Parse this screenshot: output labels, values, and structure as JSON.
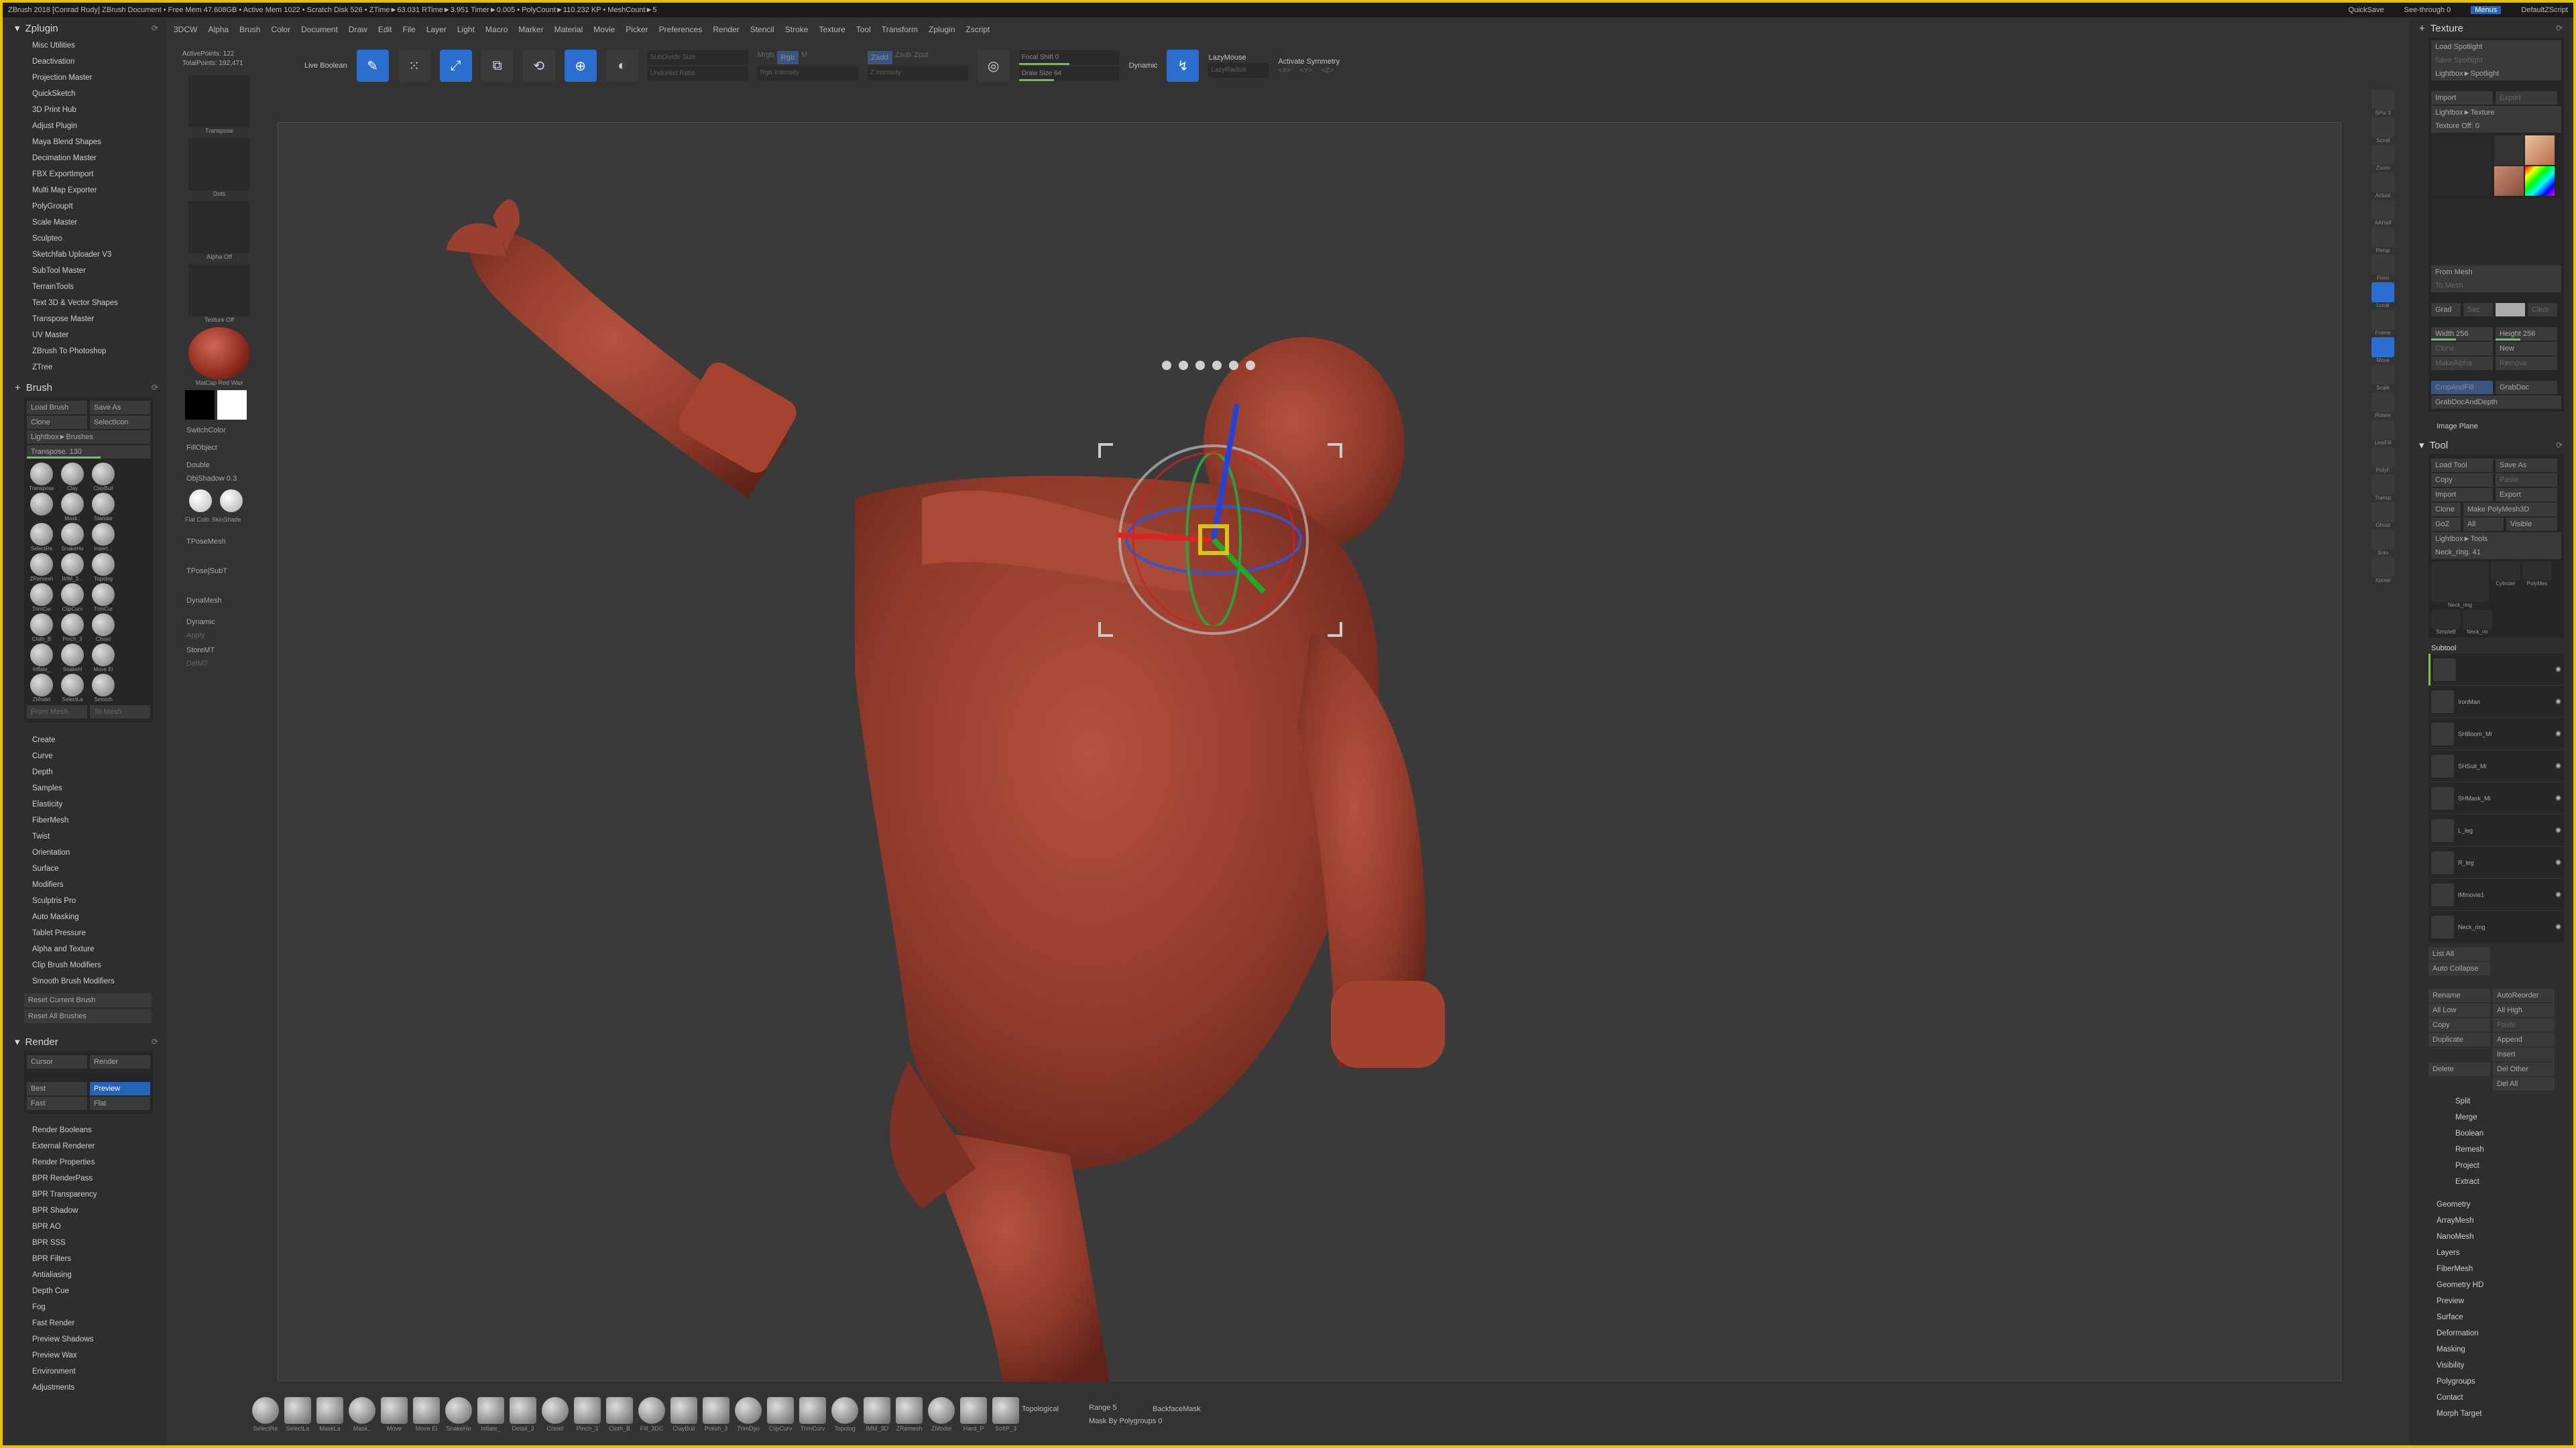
{
  "titlebar": {
    "text": "ZBrush 2018 [Conrad Rudy]   ZBrush Document   • Free Mem 47.608GB • Active Mem 1022 • Scratch Disk 526 • ZTime►63.031 RTime►3.951 Timer►0.005 • PolyCount►110.232 KP • MeshCount►5",
    "quicksave": "QuickSave",
    "seethrough": "See-through  0",
    "menus_label": "Menus",
    "defaultzscript": "DefaultZScript"
  },
  "menubar": [
    "3DCW",
    "Alpha",
    "Brush",
    "Color",
    "Document",
    "Draw",
    "Edit",
    "File",
    "Layer",
    "Light",
    "Macro",
    "Marker",
    "Material",
    "Movie",
    "Picker",
    "Preferences",
    "Render",
    "Stencil",
    "Stroke",
    "Texture",
    "Tool",
    "Transform",
    "Zplugin",
    "Zscript"
  ],
  "zplugin": {
    "title": "Zplugin",
    "items": [
      "Misc Utilities",
      "Deactivation",
      "Projection Master",
      "QuickSketch",
      "3D Print Hub",
      "Adjust Plugin",
      "Maya Blend Shapes",
      "Decimation Master",
      "FBX ExportImport",
      "Multi Map Exporter",
      "PolyGroupIt",
      "Scale Master",
      "Sculpteo",
      "Sketchfab Uploader V3",
      "SubTool Master",
      "TerrainTools",
      "Text 3D & Vector Shapes",
      "Transpose Master",
      "UV Master",
      "ZBrush To Photoshop",
      "ZTree"
    ]
  },
  "brush": {
    "title": "Brush",
    "load": "Load Brush",
    "save": "Save As",
    "clone": "Clone",
    "selecticon": "SelectIcon",
    "lightbox": "Lightbox►Brushes",
    "transpose_value": "Transpose. 130",
    "brushes": [
      [
        "Transpose",
        "Clay",
        "ClayBuil"
      ],
      [
        "",
        "Mask..",
        "Standar"
      ],
      [
        "SelectRe",
        "SnakeHo",
        "Insert..."
      ],
      [
        "ZRemesh",
        "IMM_3...",
        "Topolog"
      ],
      [
        "TrimCur",
        "ClipCurv",
        "TrimCur"
      ],
      [
        "Cloth_B",
        "Pinch_3",
        "Chisel"
      ],
      [
        "Inflate_",
        "SnakeH",
        "Move El"
      ],
      [
        "ZModel",
        "SelectLa",
        "Smooth"
      ]
    ],
    "sections": [
      "Create",
      "Curve",
      "Depth",
      "Samples",
      "Elasticity",
      "FiberMesh",
      "Twist",
      "Orientation",
      "Surface",
      "Modifiers",
      "Sculptris Pro",
      "Auto Masking",
      "Tablet Pressure",
      "Alpha and Texture",
      "Clip Brush Modifiers",
      "Smooth Brush Modifiers"
    ],
    "reset_current": "Reset Current Brush",
    "reset_all": "Reset All Brushes"
  },
  "render": {
    "title": "Render",
    "cursor": "Cursor",
    "render": "Render",
    "best": "Best",
    "preview": "Preview",
    "fast": "Fast",
    "flat": "Flat",
    "items": [
      "Render Booleans",
      "External Renderer",
      "Render Properties",
      "BPR RenderPass",
      "BPR Transparency",
      "BPR Shadow",
      "BPR AO",
      "BPR SSS",
      "BPR Filters",
      "Antialiasing",
      "Depth Cue",
      "Fog",
      "Fast Render",
      "Preview Shadows",
      "Preview Wax",
      "Environment",
      "Adjustments"
    ]
  },
  "leftshelf": {
    "active_points": "ActivePoints: 122",
    "total_points": "TotalPoints: 192,471",
    "items": [
      "Transpose",
      "Dots",
      "Alpha Off",
      "Texture Off",
      "MatCap Red Wax"
    ],
    "switchcolor": "SwitchColor",
    "fillobject": "FillObject",
    "double": "Double",
    "objshadow": "ObjShadow 0.3",
    "flat_color": "Flat Colo",
    "skinshade": "SkinShade",
    "tposemesh": "TPoseMesh",
    "tposesubt": "TPose|SubT",
    "dynamesh": "DynaMesh",
    "dynamic": "Dynamic",
    "apply": "Apply",
    "storemt": "StoreMT",
    "delmt": "DelMT"
  },
  "toolbar": {
    "live_boolean": "Live Boolean",
    "edit": "Edit",
    "draw": "Draw",
    "move": "Move",
    "scale": "Scale",
    "rotate": "Rotate",
    "subdiv_size": "SubDivide Size",
    "undohist": "UndoHist Ratio",
    "mrgb": "Mrgb",
    "rgb": "Rgb",
    "m": "M",
    "zadd": "Zadd",
    "zsub": "Zsub",
    "zcut": "Zcut",
    "rgb_intensity": "Rgb Intensity",
    "z_intensity": "Z Intensity",
    "focal_shift": "Focal Shift 0",
    "draw_size": "Draw Size 64",
    "dynamic": "Dynamic",
    "lazymouse": "LazyMouse",
    "lazyradius": "LazyRadius",
    "activate_symmetry": "Activate Symmetry",
    "sym": [
      "<X>",
      "<Y>",
      "<Z>"
    ]
  },
  "rightshelf": [
    "SPix 3",
    "Scroll",
    "Zoom",
    "Actual",
    "AAHalf",
    "Persp",
    "Floor",
    "Local",
    "Frame",
    "Move",
    "Scale",
    "Rotate",
    "LineFill",
    "PolyF",
    "Transp",
    "Ghost",
    "Solo",
    "Xpose"
  ],
  "texture": {
    "title": "Texture",
    "load_spotlight": "Load Spotlight",
    "save_spotlight": "Save Spotlight",
    "lightbox": "Lightbox►Spotlight",
    "import": "Import",
    "export": "Export",
    "lightbox_tex": "Lightbox►Texture",
    "texture_off": "Texture Off: 0",
    "from_mesh": "From Mesh",
    "to_mesh": "To Mesh",
    "grad": "Grad",
    "sec": "Sec",
    "main": "Main",
    "clear": "Clear",
    "width": "Width 256",
    "height": "Height 256",
    "clone": "Clone",
    "new": "New",
    "make_alpha": "MakeAlpha",
    "remove": "Remove",
    "cropfill": "CropAndFill",
    "grabdoc": "GrabDoc",
    "grabdoc_depth": "GrabDocAndDepth",
    "image_plane": "Image Plane"
  },
  "tool": {
    "title": "Tool",
    "load": "Load Tool",
    "save": "Save As",
    "copy": "Copy",
    "paste": "Paste",
    "import": "Import",
    "export": "Export",
    "clone": "Clone",
    "make_polymesh": "Make PolyMesh3D",
    "goz": "GoZ",
    "all": "All",
    "visible": "Visible",
    "lightbox": "Lightbox►Tools",
    "neck_ring": "Neck_ring. 41",
    "thumbs": [
      "Neck_ring",
      "Cylinder",
      "PolyMes",
      "SimpleB",
      "Neck_rin"
    ],
    "subtool_title": "Subtool",
    "subtools": [
      "",
      "IronMan",
      "SHBoom_Mi",
      "SHSuit_Mi",
      "SHMask_Mi",
      "L_leg",
      "R_leg",
      "IMmovie1",
      "Neck_ring"
    ],
    "list_all": "List All",
    "auto_collapse": "Auto Collapse",
    "rename": "Rename",
    "autoreorder": "AutoReorder",
    "all_low": "All Low",
    "all_high": "All High",
    "duplicate": "Duplicate",
    "append": "Append",
    "insert": "Insert",
    "delete": "Delete",
    "del_other": "Del Other",
    "del_all": "Del All",
    "ops": [
      "Split",
      "Merge",
      "Boolean",
      "Remesh",
      "Project",
      "Extract"
    ],
    "sections": [
      "Geometry",
      "ArrayMesh",
      "NanoMesh",
      "Layers",
      "FiberMesh",
      "Geometry HD",
      "Preview",
      "Surface",
      "Deformation",
      "Masking",
      "Visibility",
      "Polygroups",
      "Contact",
      "Morph Target"
    ]
  },
  "bottom": {
    "brushes": [
      "SelectRe",
      "SelectLa",
      "MaskLa",
      "Mask..",
      "Move",
      "Move El",
      "SnakeHo",
      "Inflate_",
      "Detail_3",
      "Chisel",
      "Pinch_3",
      "Cloth_B",
      "Fill_3DC",
      "ClayBuil",
      "Polish_3",
      "TrimDyn",
      "ClipCurv",
      "TrimCurv",
      "Topolog",
      "IMM_3D",
      "ZRemesh",
      "ZModel",
      "Hard_P",
      "SoftP_3"
    ],
    "topological": "Topological",
    "range": "Range 5",
    "backface": "BackfaceMask",
    "mask_polygroups": "Mask By Polygroups 0"
  }
}
